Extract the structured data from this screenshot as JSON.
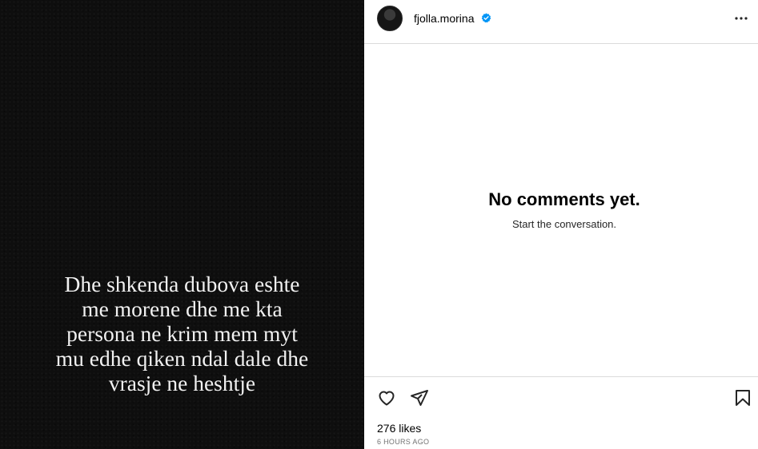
{
  "post": {
    "caption_lines": "Dhe shkenda dubova eshte\nme morene dhe me kta\npersona ne krim mem myt\nmu edhe qiken ndal dale dhe\nvrasje ne heshtje"
  },
  "header": {
    "username": "fjolla.morina",
    "verified_icon": "verified-badge-icon",
    "more_icon": "more-options-icon"
  },
  "comments": {
    "empty_title": "No comments yet.",
    "empty_subtitle": "Start the conversation."
  },
  "actions": {
    "like_icon": "heart-icon",
    "share_icon": "paper-plane-icon",
    "save_icon": "bookmark-icon",
    "likes_text": "276 likes",
    "timestamp": "6 HOURS AGO"
  },
  "colors": {
    "verified": "#0095f6",
    "border": "#dbdbdb",
    "muted": "#737373",
    "media_background": "#0e0e0e"
  }
}
